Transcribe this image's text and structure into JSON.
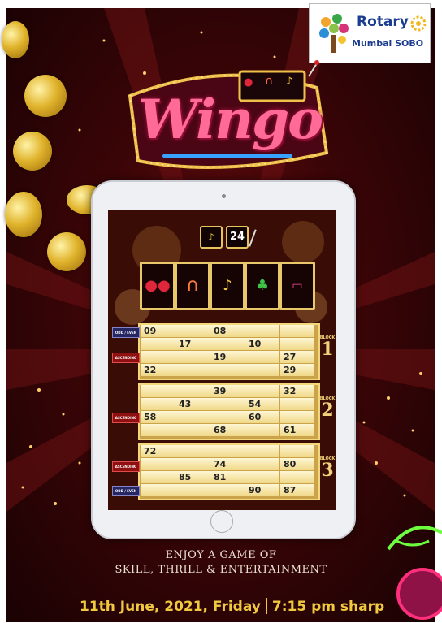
{
  "org": {
    "name": "Rotary",
    "club": "Mumbai SOBO"
  },
  "logo": {
    "text": "Wingo",
    "reels": [
      "cherry-icon",
      "horseshoe-icon",
      "bell-icon"
    ]
  },
  "draw": {
    "icon": "bell-icon",
    "number": "24"
  },
  "reels": [
    "cherry-icon",
    "horseshoe-icon",
    "bell-icon",
    "clover-icon",
    "ticket-icon"
  ],
  "side_labels": {
    "odd_even": "ODD / EVEN",
    "ascending": "ASCENDING"
  },
  "blocks": [
    {
      "label": "BLOCK",
      "number": "1",
      "rows": [
        [
          "09",
          "",
          "08",
          "",
          ""
        ],
        [
          "",
          "17",
          "",
          "10",
          ""
        ],
        [
          "",
          "",
          "19",
          "",
          "27"
        ],
        [
          "22",
          "",
          "",
          "",
          "29"
        ]
      ]
    },
    {
      "label": "BLOCK",
      "number": "2",
      "rows": [
        [
          "",
          "",
          "39",
          "",
          "32"
        ],
        [
          "",
          "43",
          "",
          "54",
          ""
        ],
        [
          "58",
          "",
          "",
          "60",
          ""
        ],
        [
          "",
          "",
          "68",
          "",
          "61"
        ]
      ]
    },
    {
      "label": "BLOCK",
      "number": "3",
      "rows": [
        [
          "72",
          "",
          "",
          "",
          ""
        ],
        [
          "",
          "",
          "74",
          "",
          "80"
        ],
        [
          "",
          "85",
          "81",
          "",
          ""
        ],
        [
          "",
          "",
          "",
          "90",
          "87"
        ]
      ]
    }
  ],
  "tagline": {
    "line1": "ENJOY A GAME OF",
    "line2": "SKILL, THRILL & ENTERTAINMENT"
  },
  "event": {
    "date": "11th June, 2021, Friday",
    "time": "7:15 pm sharp"
  },
  "colors": {
    "gold": "#f1c93f",
    "background": "#3b0507",
    "rotary_blue": "#1b3c8f"
  }
}
